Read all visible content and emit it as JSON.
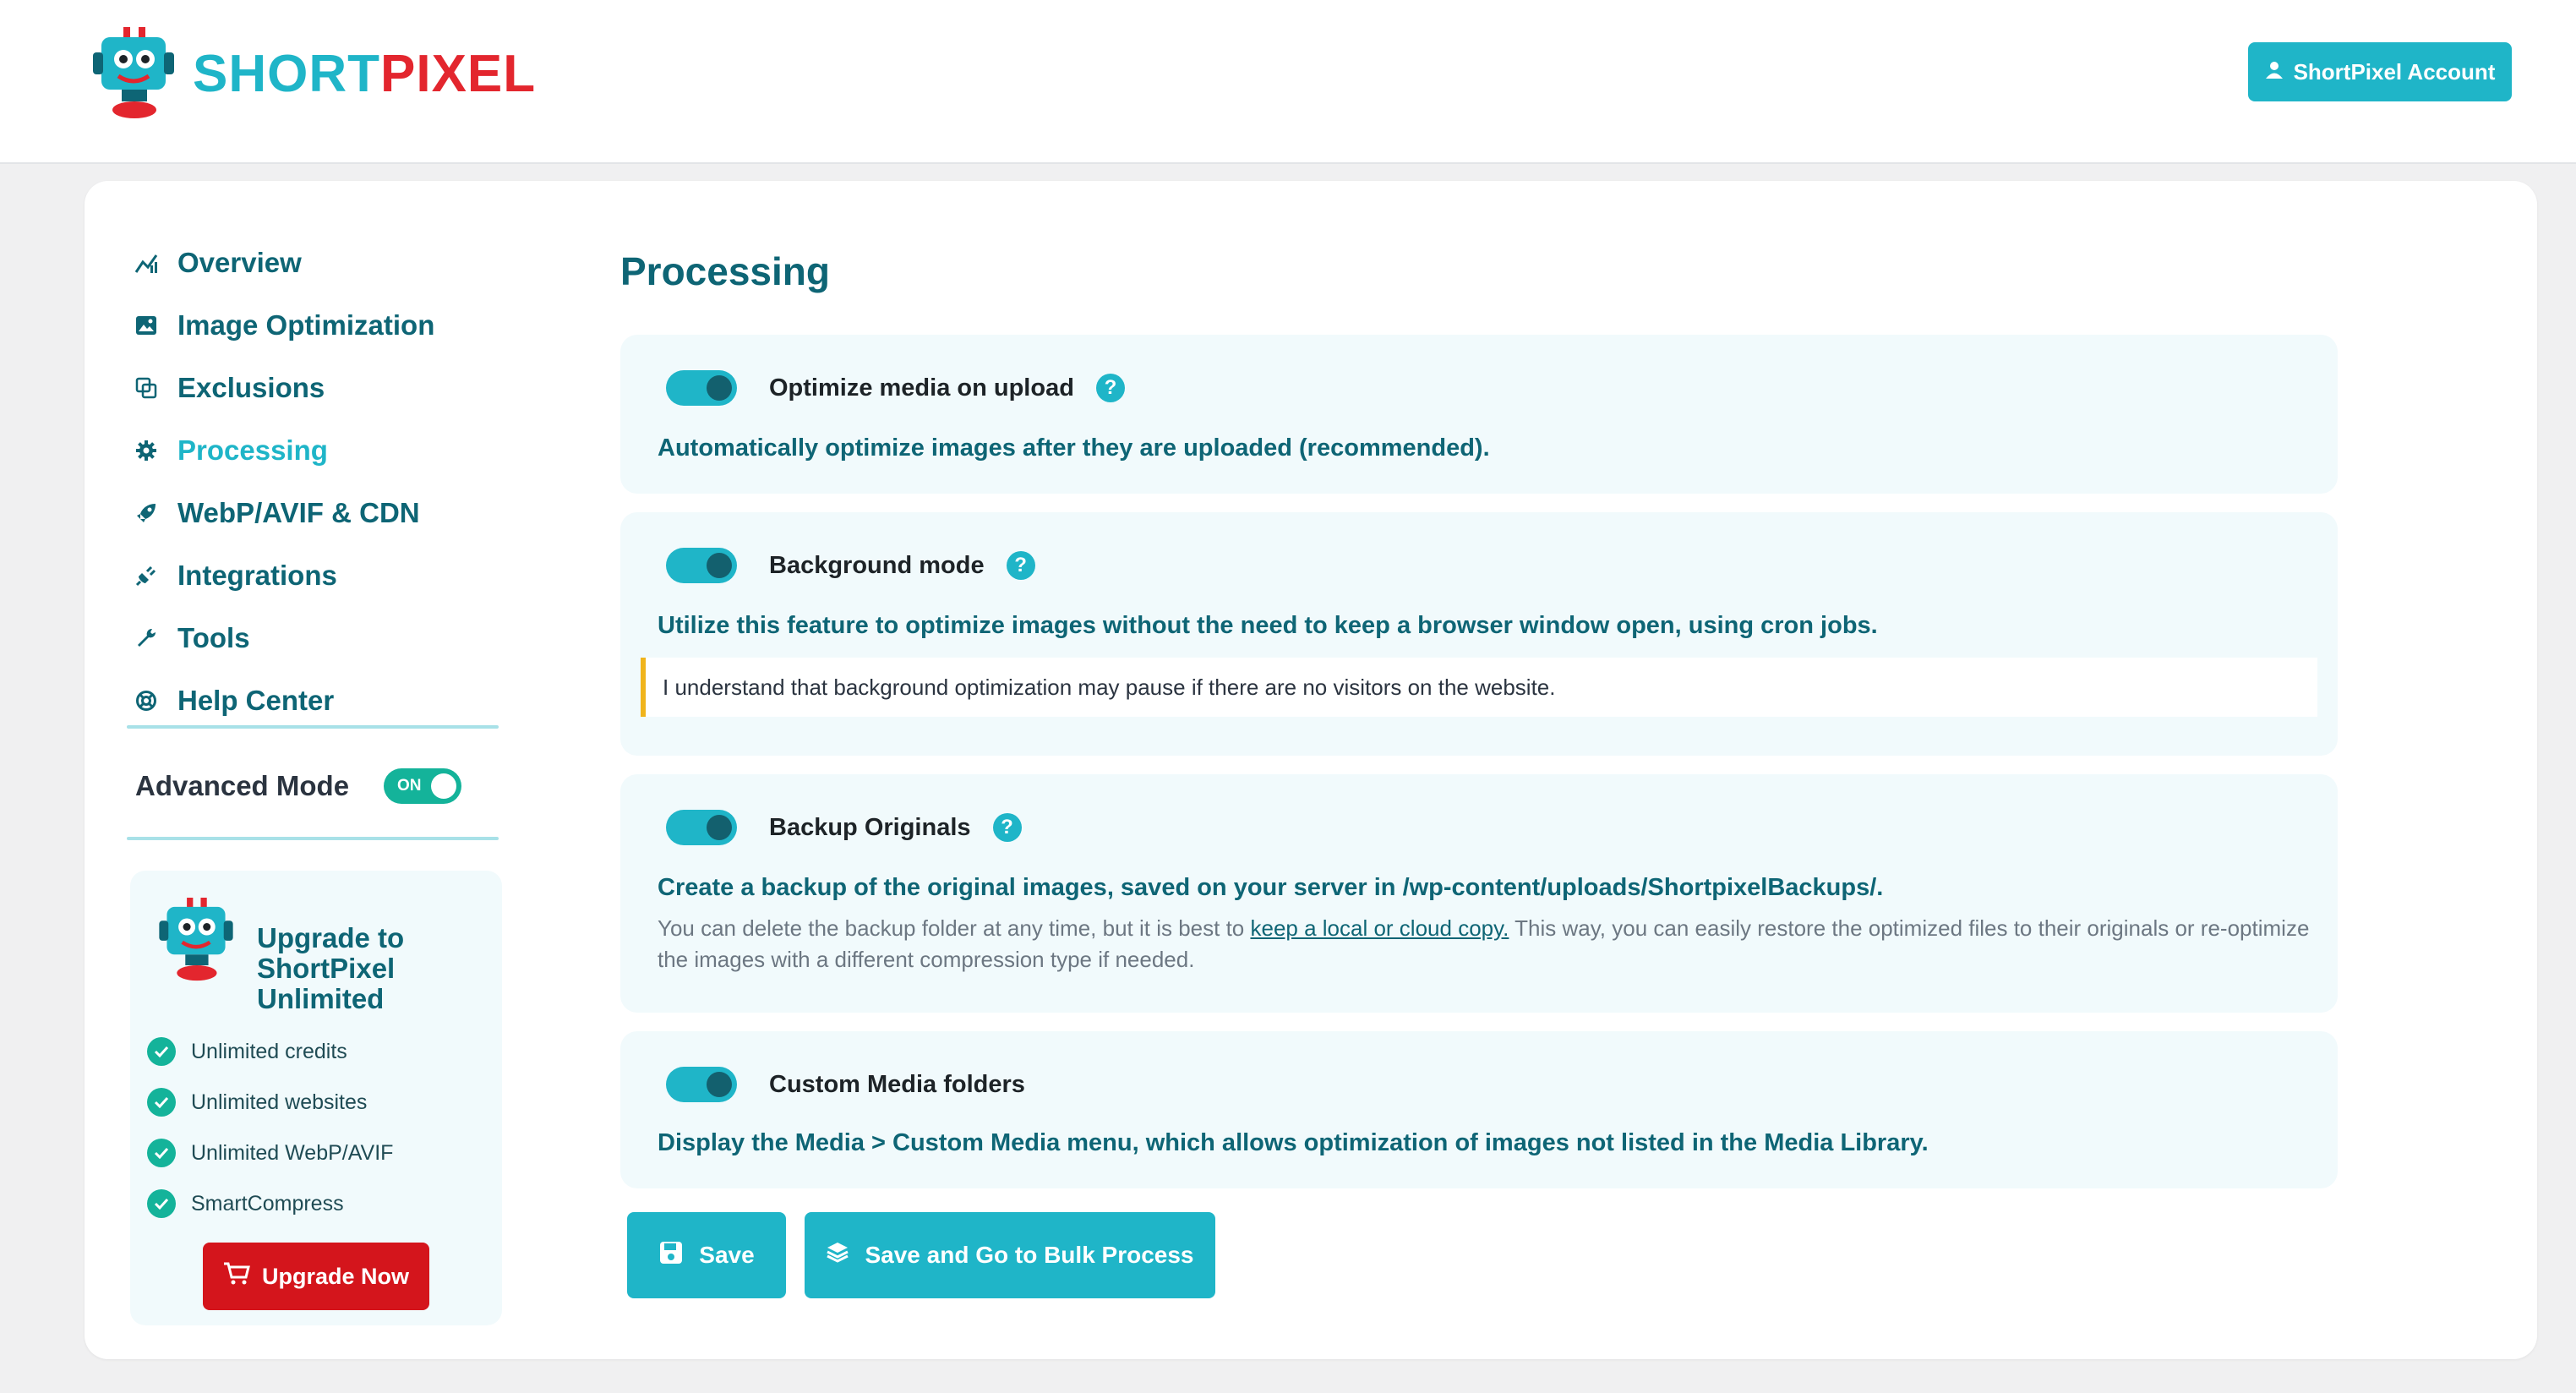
{
  "brand": {
    "part1": "SHORT",
    "part2": "PIXEL"
  },
  "header": {
    "account_button": "ShortPixel Account"
  },
  "sidebar": {
    "items": [
      {
        "label": "Overview",
        "icon": "chart-icon"
      },
      {
        "label": "Image Optimization",
        "icon": "image-icon"
      },
      {
        "label": "Exclusions",
        "icon": "exclusions-icon"
      },
      {
        "label": "Processing",
        "icon": "gear-icon"
      },
      {
        "label": "WebP/AVIF & CDN",
        "icon": "rocket-icon"
      },
      {
        "label": "Integrations",
        "icon": "plug-icon"
      },
      {
        "label": "Tools",
        "icon": "wrench-icon"
      },
      {
        "label": "Help Center",
        "icon": "lifebuoy-icon"
      }
    ],
    "active": "Processing",
    "advanced_mode": {
      "label": "Advanced Mode",
      "state": "ON"
    }
  },
  "upgrade": {
    "title": "Upgrade to ShortPixel Unlimited",
    "features": [
      "Unlimited credits",
      "Unlimited websites",
      "Unlimited WebP/AVIF",
      "SmartCompress"
    ],
    "button": "Upgrade Now"
  },
  "main": {
    "title": "Processing",
    "settings": [
      {
        "label": "Optimize media on upload",
        "enabled": true,
        "help": "?",
        "description": "Automatically optimize images after they are uploaded (recommended)."
      },
      {
        "label": "Background mode",
        "enabled": true,
        "help": "?",
        "description": "Utilize this feature to optimize images without the need to keep a browser window open, using cron jobs.",
        "notice": "I understand that background optimization may pause if there are no visitors on the website."
      },
      {
        "label": "Backup Originals",
        "enabled": true,
        "help": "?",
        "description": "Create a backup of the original images, saved on your server in /wp-content/uploads/ShortpixelBackups/.",
        "detail_before": "You can delete the backup folder at any time, but it is best to ",
        "detail_link": "keep a local or cloud copy.",
        "detail_after": " This way, you can easily restore the optimized files to their originals or re-optimize the images with a different compression type if needed."
      },
      {
        "label": "Custom Media folders",
        "enabled": true,
        "description": "Display the Media > Custom Media menu, which allows optimization of images not listed in the Media Library."
      }
    ],
    "save_button": "Save",
    "save_bulk_button": "Save and Go to Bulk Process"
  },
  "colors": {
    "accent": "#1fb5c8",
    "dark_teal": "#0e6575",
    "brand_red": "#e3262e",
    "upgrade_red": "#d4151c",
    "success_green": "#14b39a",
    "notice_yellow": "#f0b41c"
  }
}
